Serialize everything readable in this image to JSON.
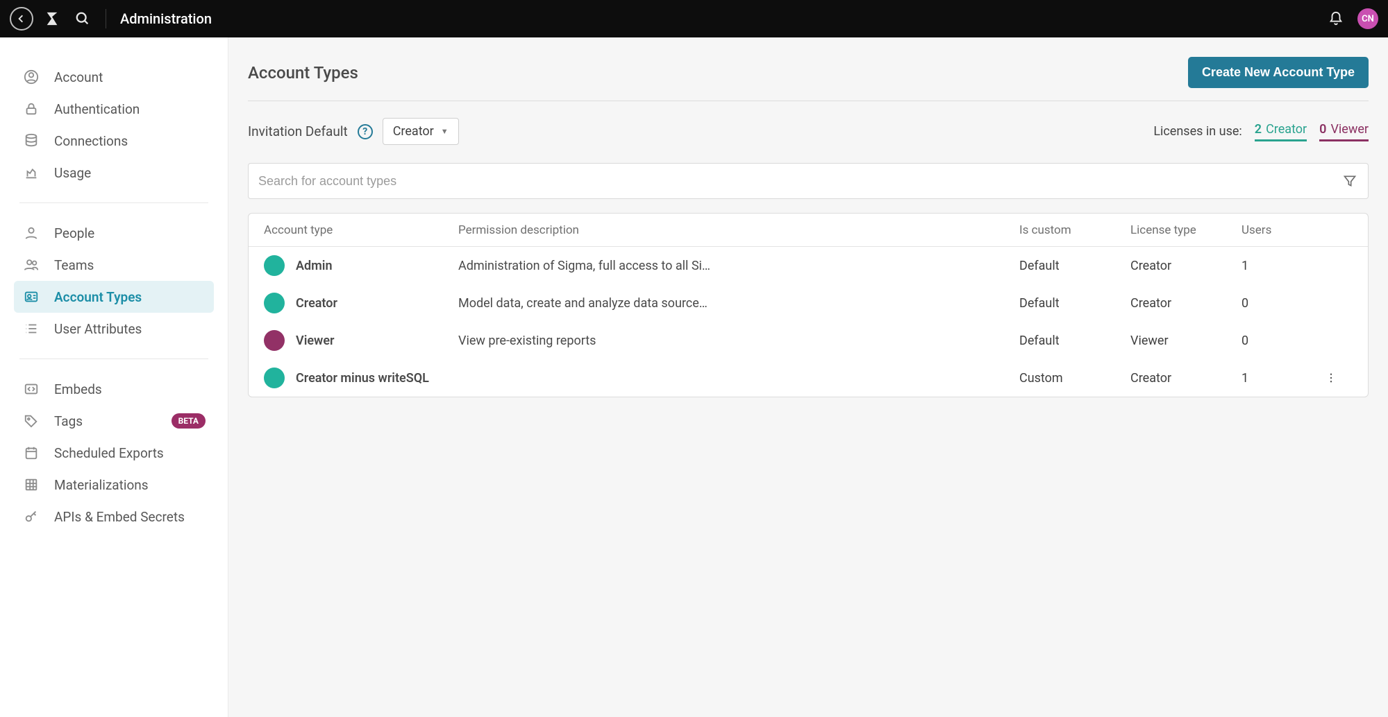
{
  "topbar": {
    "title": "Administration",
    "avatar_initials": "CN"
  },
  "sidebar": {
    "items": [
      {
        "label": "Account",
        "icon": "user-circle"
      },
      {
        "label": "Authentication",
        "icon": "lock"
      },
      {
        "label": "Connections",
        "icon": "database"
      },
      {
        "label": "Usage",
        "icon": "chart-up"
      }
    ],
    "items2": [
      {
        "label": "People",
        "icon": "person"
      },
      {
        "label": "Teams",
        "icon": "people"
      },
      {
        "label": "Account Types",
        "icon": "id-card",
        "selected": true
      },
      {
        "label": "User Attributes",
        "icon": "list"
      }
    ],
    "items3": [
      {
        "label": "Embeds",
        "icon": "code"
      },
      {
        "label": "Tags",
        "icon": "tag",
        "badge": "BETA"
      },
      {
        "label": "Scheduled Exports",
        "icon": "calendar"
      },
      {
        "label": "Materializations",
        "icon": "grid"
      },
      {
        "label": "APIs & Embed Secrets",
        "icon": "key"
      }
    ]
  },
  "main": {
    "page_title": "Account Types",
    "create_btn": "Create New Account Type",
    "invitation_default_label": "Invitation Default",
    "invitation_default_value": "Creator",
    "licenses_label": "Licenses in use:",
    "license_creator_count": "2",
    "license_creator_label": "Creator",
    "license_viewer_count": "0",
    "license_viewer_label": "Viewer",
    "search_placeholder": "Search for account types",
    "columns": {
      "name": "Account type",
      "desc": "Permission description",
      "custom": "Is custom",
      "license": "License type",
      "users": "Users"
    },
    "rows": [
      {
        "name": "Admin",
        "color": "teal",
        "desc": "Administration of Sigma, full access to all Si…",
        "custom": "Default",
        "license": "Creator",
        "users": "1",
        "actions": false
      },
      {
        "name": "Creator",
        "color": "teal",
        "desc": "Model data, create and analyze data source…",
        "custom": "Default",
        "license": "Creator",
        "users": "0",
        "actions": false
      },
      {
        "name": "Viewer",
        "color": "purple",
        "desc": "View pre-existing reports",
        "custom": "Default",
        "license": "Viewer",
        "users": "0",
        "actions": false
      },
      {
        "name": "Creator minus writeSQL",
        "color": "teal",
        "desc": "",
        "custom": "Custom",
        "license": "Creator",
        "users": "1",
        "actions": true
      }
    ]
  }
}
